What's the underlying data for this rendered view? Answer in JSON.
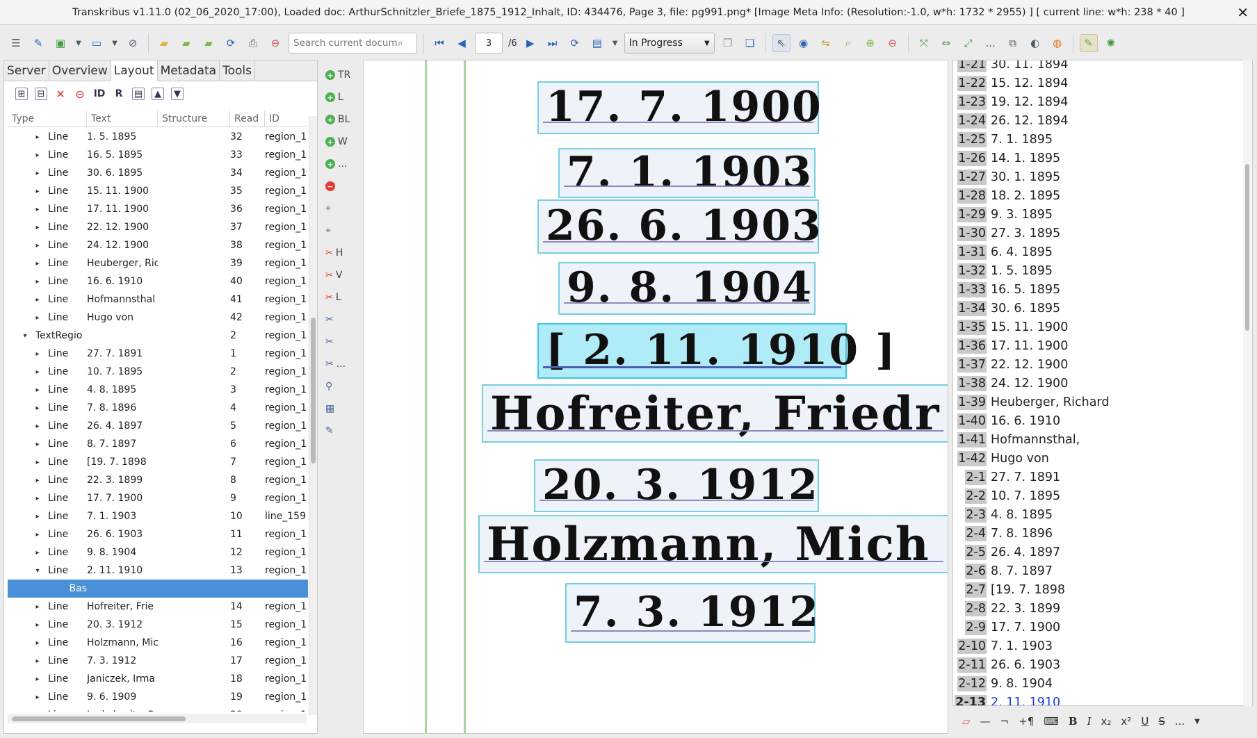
{
  "window": {
    "title": "Transkribus v1.11.0 (02_06_2020_17:00), Loaded doc: ArthurSchnitzler_Briefe_1875_1912_Inhalt, ID: 434476, Page 3, file: pg991.png* [Image Meta Info: (Resolution:-1.0, w*h: 1732 * 2955) ] [ current line: w*h: 238 * 40 ]",
    "close_glyph": "✕"
  },
  "toolbar": {
    "search_placeholder": "Search current document...",
    "page_current": "3",
    "page_total": "/6",
    "status_value": "In Progress",
    "more_label": "..."
  },
  "left_panel": {
    "tabs": [
      "Server",
      "Overview",
      "Layout",
      "Metadata",
      "Tools"
    ],
    "active_tab": "Layout",
    "columns": [
      "Type",
      "Text",
      "Structure",
      "Read",
      "ID"
    ],
    "rows": [
      {
        "type": "Line",
        "text": "1. 5. 1895",
        "read": "32",
        "id": "region_1",
        "indent": 2,
        "exp": "▸"
      },
      {
        "type": "Line",
        "text": "16. 5. 1895",
        "read": "33",
        "id": "region_1",
        "indent": 2,
        "exp": "▸"
      },
      {
        "type": "Line",
        "text": "30. 6. 1895",
        "read": "34",
        "id": "region_1",
        "indent": 2,
        "exp": "▸"
      },
      {
        "type": "Line",
        "text": "15. 11. 1900",
        "read": "35",
        "id": "region_1",
        "indent": 2,
        "exp": "▸"
      },
      {
        "type": "Line",
        "text": "17. 11. 1900",
        "read": "36",
        "id": "region_1",
        "indent": 2,
        "exp": "▸"
      },
      {
        "type": "Line",
        "text": "22. 12. 1900",
        "read": "37",
        "id": "region_1",
        "indent": 2,
        "exp": "▸"
      },
      {
        "type": "Line",
        "text": "24. 12. 1900",
        "read": "38",
        "id": "region_1",
        "indent": 2,
        "exp": "▸"
      },
      {
        "type": "Line",
        "text": "Heuberger, Ric",
        "read": "39",
        "id": "region_1",
        "indent": 2,
        "exp": "▸"
      },
      {
        "type": "Line",
        "text": "16. 6. 1910",
        "read": "40",
        "id": "region_1",
        "indent": 2,
        "exp": "▸"
      },
      {
        "type": "Line",
        "text": "Hofmannsthal",
        "read": "41",
        "id": "region_1",
        "indent": 2,
        "exp": "▸"
      },
      {
        "type": "Line",
        "text": "Hugo von",
        "read": "42",
        "id": "region_1",
        "indent": 2,
        "exp": "▸"
      },
      {
        "type": "TextRegio",
        "text": "",
        "read": "2",
        "id": "region_1",
        "indent": 1,
        "exp": "▾"
      },
      {
        "type": "Line",
        "text": "27. 7. 1891",
        "read": "1",
        "id": "region_1",
        "indent": 2,
        "exp": "▸"
      },
      {
        "type": "Line",
        "text": "10. 7. 1895",
        "read": "2",
        "id": "region_1",
        "indent": 2,
        "exp": "▸"
      },
      {
        "type": "Line",
        "text": "4. 8. 1895",
        "read": "3",
        "id": "region_1",
        "indent": 2,
        "exp": "▸"
      },
      {
        "type": "Line",
        "text": "7. 8. 1896",
        "read": "4",
        "id": "region_1",
        "indent": 2,
        "exp": "▸"
      },
      {
        "type": "Line",
        "text": "26. 4. 1897",
        "read": "5",
        "id": "region_1",
        "indent": 2,
        "exp": "▸"
      },
      {
        "type": "Line",
        "text": "8. 7. 1897",
        "read": "6",
        "id": "region_1",
        "indent": 2,
        "exp": "▸"
      },
      {
        "type": "Line",
        "text": "[19. 7. 1898",
        "read": "7",
        "id": "region_1",
        "indent": 2,
        "exp": "▸"
      },
      {
        "type": "Line",
        "text": "22. 3. 1899",
        "read": "8",
        "id": "region_1",
        "indent": 2,
        "exp": "▸"
      },
      {
        "type": "Line",
        "text": "17. 7. 1900",
        "read": "9",
        "id": "region_1",
        "indent": 2,
        "exp": "▸"
      },
      {
        "type": "Line",
        "text": "7. 1. 1903",
        "read": "10",
        "id": "line_159",
        "indent": 2,
        "exp": "▸"
      },
      {
        "type": "Line",
        "text": "26. 6. 1903",
        "read": "11",
        "id": "region_1",
        "indent": 2,
        "exp": "▸"
      },
      {
        "type": "Line",
        "text": "9. 8. 1904",
        "read": "12",
        "id": "region_1",
        "indent": 2,
        "exp": "▸"
      },
      {
        "type": "Line",
        "text": "2. 11. 1910",
        "read": "13",
        "id": "region_1",
        "indent": 2,
        "exp": "▾"
      },
      {
        "type": "Bas",
        "text": "",
        "read": "",
        "id": "",
        "indent": 3,
        "exp": "",
        "selected": true
      },
      {
        "type": "Line",
        "text": "Hofreiter, Frie",
        "read": "14",
        "id": "region_1",
        "indent": 2,
        "exp": "▸"
      },
      {
        "type": "Line",
        "text": "20. 3. 1912",
        "read": "15",
        "id": "region_1",
        "indent": 2,
        "exp": "▸"
      },
      {
        "type": "Line",
        "text": "Holzmann, Mic",
        "read": "16",
        "id": "region_1",
        "indent": 2,
        "exp": "▸"
      },
      {
        "type": "Line",
        "text": "7. 3. 1912",
        "read": "17",
        "id": "region_1",
        "indent": 2,
        "exp": "▸"
      },
      {
        "type": "Line",
        "text": "Janiczek, Irma",
        "read": "18",
        "id": "region_1",
        "indent": 2,
        "exp": "▸"
      },
      {
        "type": "Line",
        "text": "9. 6. 1909",
        "read": "19",
        "id": "region_1",
        "indent": 2,
        "exp": "▸"
      },
      {
        "type": "Line",
        "text": "Jankolowitz, S",
        "read": "20",
        "id": "region_1",
        "indent": 2,
        "exp": "▸"
      }
    ]
  },
  "side_tools": [
    {
      "kind": "add",
      "label": "TR"
    },
    {
      "kind": "add",
      "label": "L"
    },
    {
      "kind": "add",
      "label": "BL"
    },
    {
      "kind": "add",
      "label": "W"
    },
    {
      "kind": "add",
      "label": "..."
    },
    {
      "kind": "remove",
      "label": ""
    },
    {
      "kind": "icon",
      "label": ""
    },
    {
      "kind": "icon",
      "label": ""
    },
    {
      "kind": "split",
      "label": "H"
    },
    {
      "kind": "split",
      "label": "V"
    },
    {
      "kind": "split",
      "label": "L"
    },
    {
      "kind": "icon",
      "label": ""
    },
    {
      "kind": "icon",
      "label": ""
    },
    {
      "kind": "icon",
      "label": "..."
    },
    {
      "kind": "icon",
      "label": ""
    },
    {
      "kind": "icon",
      "label": ""
    },
    {
      "kind": "icon",
      "label": ""
    }
  ],
  "canvas": {
    "scan_lines": [
      {
        "text": "17. 7. 1900"
      },
      {
        "text": "7. 1. 1903"
      },
      {
        "text": "26. 6. 1903"
      },
      {
        "text": "9. 8. 1904"
      },
      {
        "text": "[ 2. 11. 1910 ]",
        "active": true
      },
      {
        "text": "Hofreiter, Friedr"
      },
      {
        "text": "20. 3. 1912"
      },
      {
        "text": "Holzmann, Mich"
      },
      {
        "text": "7. 3. 1912"
      }
    ]
  },
  "transcription": {
    "rows": [
      {
        "num": "1-21",
        "text": "30. 11. 1894"
      },
      {
        "num": "1-22",
        "text": "15. 12. 1894"
      },
      {
        "num": "1-23",
        "text": "19. 12. 1894"
      },
      {
        "num": "1-24",
        "text": "26. 12. 1894"
      },
      {
        "num": "1-25",
        "text": "7. 1. 1895"
      },
      {
        "num": "1-26",
        "text": "14. 1. 1895"
      },
      {
        "num": "1-27",
        "text": "30. 1. 1895"
      },
      {
        "num": "1-28",
        "text": "18. 2. 1895"
      },
      {
        "num": "1-29",
        "text": "9. 3. 1895"
      },
      {
        "num": "1-30",
        "text": "27. 3. 1895"
      },
      {
        "num": "1-31",
        "text": "6. 4. 1895"
      },
      {
        "num": "1-32",
        "text": "1. 5. 1895"
      },
      {
        "num": "1-33",
        "text": "16. 5. 1895"
      },
      {
        "num": "1-34",
        "text": "30. 6. 1895"
      },
      {
        "num": "1-35",
        "text": "15. 11. 1900"
      },
      {
        "num": "1-36",
        "text": "17. 11. 1900"
      },
      {
        "num": "1-37",
        "text": "22. 12. 1900"
      },
      {
        "num": "1-38",
        "text": "24. 12. 1900"
      },
      {
        "num": "1-39",
        "text": "Heuberger, Richard"
      },
      {
        "num": "1-40",
        "text": "16. 6. 1910"
      },
      {
        "num": "1-41",
        "text": "Hofmannsthal,"
      },
      {
        "num": "1-42",
        "text": "Hugo von"
      },
      {
        "num": "2-1",
        "text": "27. 7. 1891"
      },
      {
        "num": "2-2",
        "text": "10. 7. 1895"
      },
      {
        "num": "2-3",
        "text": "4. 8. 1895"
      },
      {
        "num": "2-4",
        "text": "7. 8. 1896"
      },
      {
        "num": "2-5",
        "text": "26. 4. 1897"
      },
      {
        "num": "2-6",
        "text": "8. 7. 1897"
      },
      {
        "num": "2-7",
        "text": "[19. 7. 1898"
      },
      {
        "num": "2-8",
        "text": "22. 3. 1899"
      },
      {
        "num": "2-9",
        "text": "17. 7. 1900"
      },
      {
        "num": "2-10",
        "text": "7. 1. 1903"
      },
      {
        "num": "2-11",
        "text": "26. 6. 1903"
      },
      {
        "num": "2-12",
        "text": "9. 8. 1904"
      },
      {
        "num": "2-13",
        "text": "2. 11. 1910",
        "current": true
      }
    ]
  },
  "format_bar": {
    "bold": "B",
    "italic": "I",
    "sub": "x₂",
    "sup": "x²",
    "underline": "U",
    "strike": "S",
    "more": "..."
  },
  "icons": {
    "menu": "☰",
    "search": "🔍",
    "first": "⏮",
    "prev": "◀",
    "next": "▶",
    "last": "⏭",
    "reload": "⟳",
    "save": "💾",
    "dropdown": "▼"
  }
}
